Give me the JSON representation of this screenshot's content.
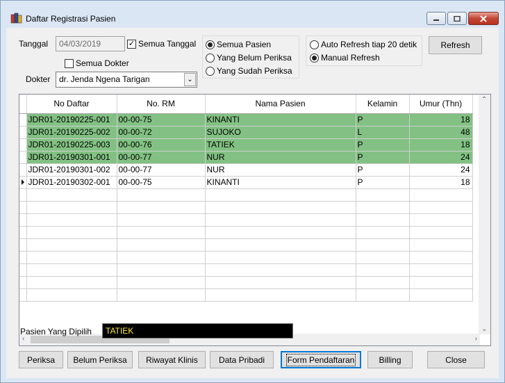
{
  "window": {
    "title": "Daftar Registrasi Pasien",
    "icon": "app-stack-icon"
  },
  "filters": {
    "tanggal_label": "Tanggal",
    "tanggal_value": "04/03/2019",
    "semua_tanggal_label": "Semua Tanggal",
    "semua_tanggal_checked": true,
    "semua_dokter_label": "Semua Dokter",
    "semua_dokter_checked": false,
    "dokter_label": "Dokter",
    "dokter_value": "dr. Jenda Ngena Tarigan"
  },
  "patient_filter": {
    "options": [
      "Semua Pasien",
      "Yang Belum Periksa",
      "Yang Sudah Periksa"
    ],
    "selected": 0
  },
  "refresh_mode": {
    "options": [
      "Auto Refresh tiap 20 detik",
      "Manual Refresh"
    ],
    "selected": 1
  },
  "refresh_button": "Refresh",
  "table": {
    "columns": [
      "No Daftar",
      "No. RM",
      "Nama Pasien",
      "Kelamin",
      "Umur (Thn)"
    ],
    "rows": [
      {
        "no_daftar": "JDR01-20190225-001",
        "no_rm": "00-00-75",
        "nama": "KINANTI",
        "kelamin": "P",
        "umur": "18",
        "highlight": true
      },
      {
        "no_daftar": "JDR01-20190225-002",
        "no_rm": "00-00-72",
        "nama": "SUJOKO",
        "kelamin": "L",
        "umur": "48",
        "highlight": true
      },
      {
        "no_daftar": "JDR01-20190225-003",
        "no_rm": "00-00-76",
        "nama": "TATIEK",
        "kelamin": "P",
        "umur": "18",
        "highlight": true
      },
      {
        "no_daftar": "JDR01-20190301-001",
        "no_rm": "00-00-77",
        "nama": "NUR",
        "kelamin": "P",
        "umur": "24",
        "highlight": true
      },
      {
        "no_daftar": "JDR01-20190301-002",
        "no_rm": "00-00-77",
        "nama": "NUR",
        "kelamin": "P",
        "umur": "24",
        "highlight": false
      },
      {
        "no_daftar": "JDR01-20190302-001",
        "no_rm": "00-00-75",
        "nama": "KINANTI",
        "kelamin": "P",
        "umur": "18",
        "highlight": false,
        "current": true
      }
    ],
    "empty_rows": 9,
    "highlight_color": "#82c183"
  },
  "selected_patient": {
    "label": "Pasien Yang Dipilih",
    "value": "TATIEK"
  },
  "buttons": {
    "periksa": "Periksa",
    "belum_periksa": "Belum Periksa",
    "riwayat_klinis": "Riwayat Klinis",
    "data_pribadi": "Data Pribadi",
    "form_pendaftaran": "Form Pendaftaran",
    "billing": "Billing",
    "close": "Close"
  }
}
